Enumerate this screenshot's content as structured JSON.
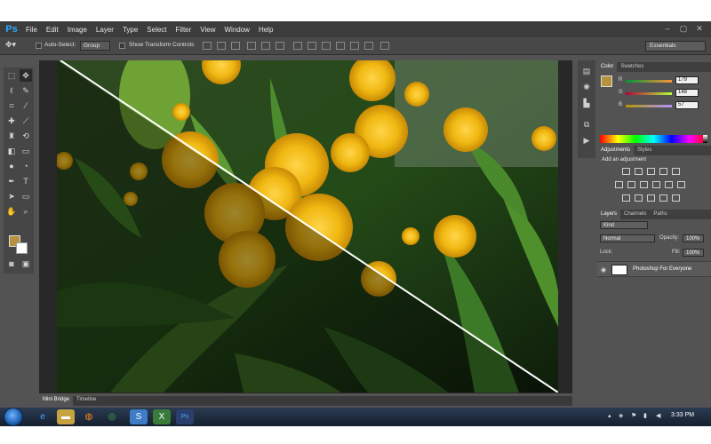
{
  "app": {
    "logo": "Ps",
    "menu": [
      "File",
      "Edit",
      "Image",
      "Layer",
      "Type",
      "Select",
      "Filter",
      "View",
      "Window",
      "Help"
    ],
    "window_controls": [
      "–",
      "▢",
      "✕"
    ]
  },
  "options_bar": {
    "auto_select_label": "Auto-Select:",
    "auto_select_value": "Group",
    "show_transform_label": "Show Transform Controls",
    "workspace": "Essentials"
  },
  "canvas": {
    "bottom_tabs": [
      "Mini Bridge",
      "Timeline"
    ]
  },
  "color_panel": {
    "tabs": [
      "Color",
      "Swatches"
    ],
    "r_label": "R",
    "r_value": "179",
    "g_label": "G",
    "g_value": "148",
    "b_label": "B",
    "b_value": "57",
    "foreground_color": "#b3943a"
  },
  "adjustments_panel": {
    "tabs": [
      "Adjustments",
      "Styles"
    ],
    "heading": "Add an adjustment"
  },
  "layers_panel": {
    "tabs": [
      "Layers",
      "Channels",
      "Paths"
    ],
    "kind_value": "Kind",
    "blend_mode": "Normal",
    "opacity_label": "Opacity:",
    "opacity_value": "100%",
    "lock_label": "Lock:",
    "fill_label": "Fill:",
    "fill_value": "100%",
    "layer_name": "Photoshop For Everyone"
  },
  "taskbar": {
    "clock": "3:33 PM",
    "apps": [
      "ie-icon",
      "explorer-icon",
      "firefox-icon",
      "chrome-icon",
      "skype-icon",
      "excel-icon",
      "photoshop-icon"
    ]
  }
}
